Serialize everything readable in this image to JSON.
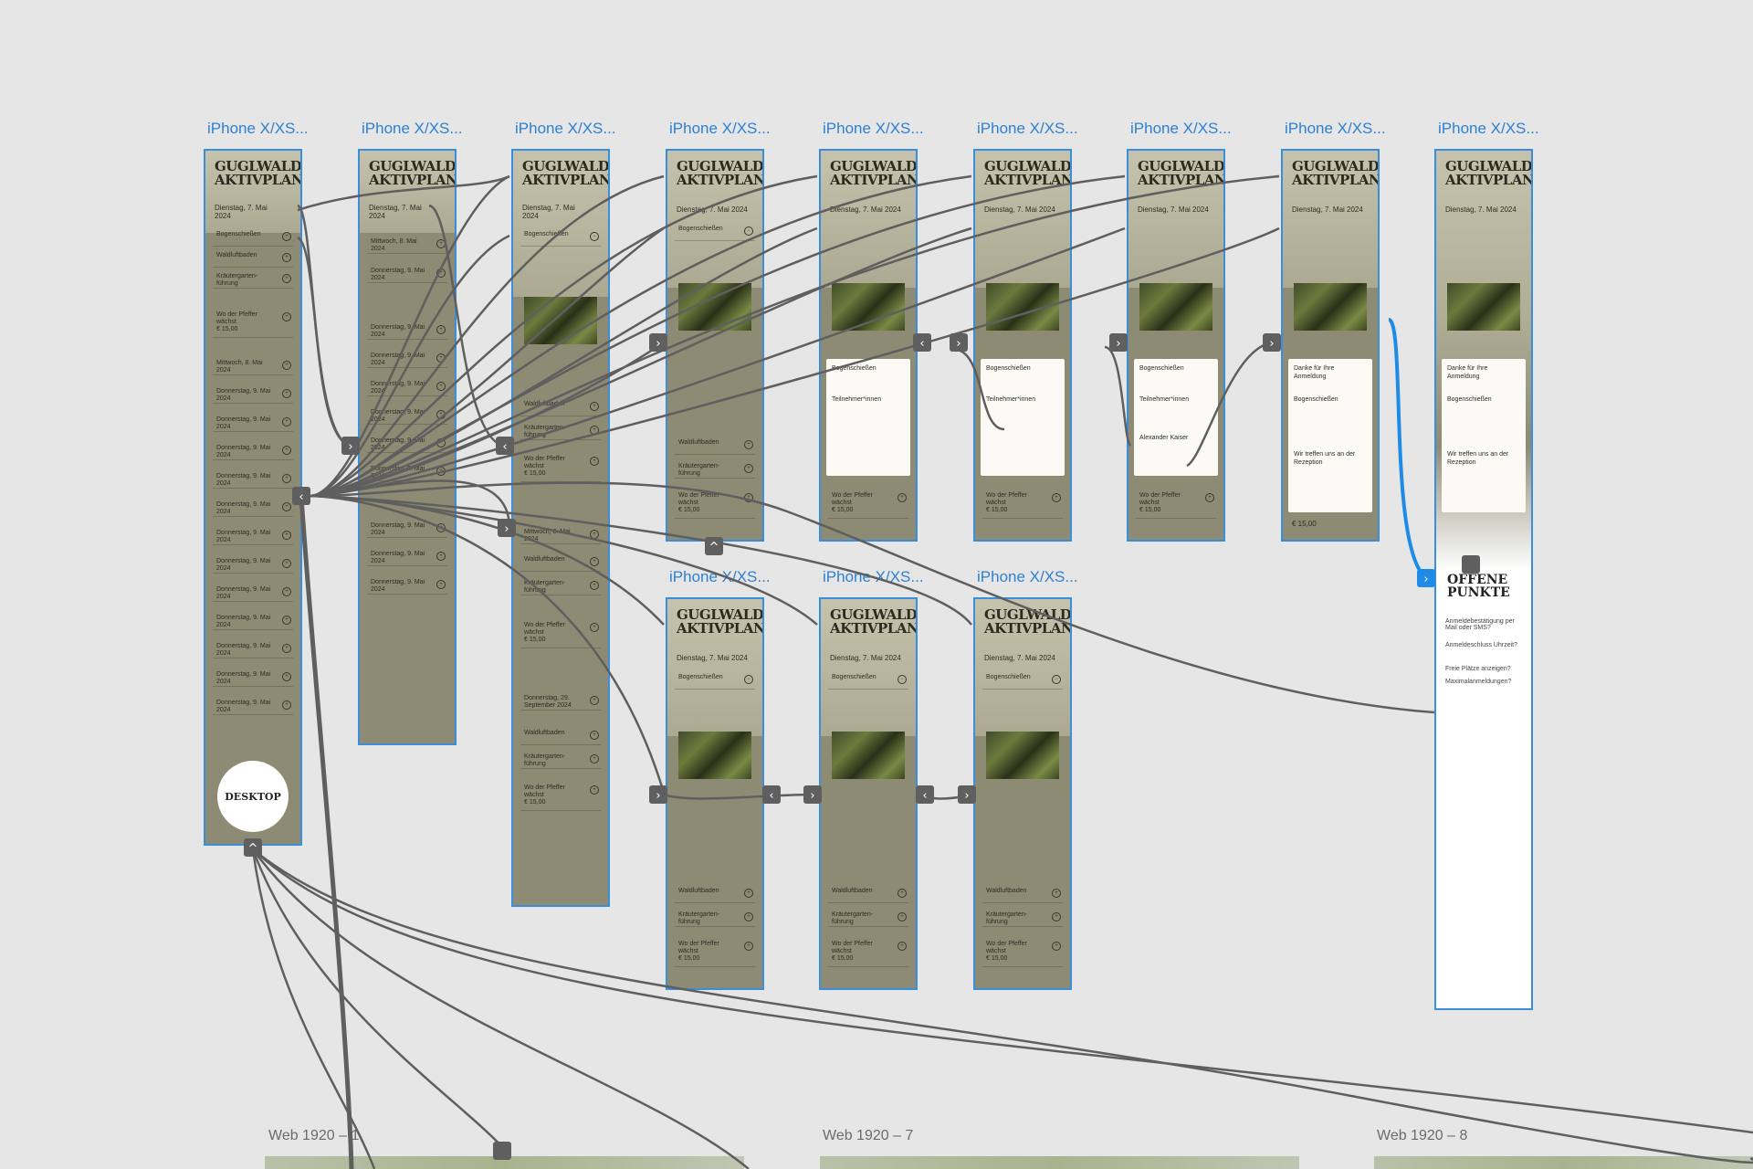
{
  "artboard_label": "iPhone X/XS...",
  "logo_line1": "GUGLWALD",
  "logo_line2": "AKTIVPLAN",
  "desktop_label": "DESKTOP",
  "web_labels": [
    "Web 1920 – 1",
    "Web 1920 – 7",
    "Web 1920 – 8"
  ],
  "offene_line1": "OFFENE",
  "offene_line2": "PUNKTE",
  "offene_items": [
    "Anmeldebestätigung per Mail oder SMS?",
    "Anmeldeschluss Uhrzeit?",
    "Freie Plätze anzeigen?",
    "Maximalanmeldungen?"
  ],
  "date_short": "Dienstag, 7. Mai 2024",
  "list_rows": [
    "Bogenschießen",
    "Waldluftbaden",
    "Kräutergarten-führung",
    "Wo der Pfeffer wächst"
  ],
  "price": "€ 15,00",
  "list_dates": [
    "Mittwoch, 8. Mai 2024",
    "Donnerstag, 9. Mai 2024",
    "Donnerstag, 9. Mai 2024",
    "Donnerstag, 9. Mai 2024",
    "Donnerstag, 9. Mai 2024",
    "Donnerstag, 9. Mai 2024",
    "Donnerstag, 9. Mai 2024",
    "Donnerstag, 9. Mai 2024",
    "Donnerstag, 9. Mai 2024",
    "Donnerstag, 9. Mai 2024",
    "Donnerstag, 9. Mai 2024",
    "Donnerstag, 9. Mai 2024",
    "Donnerstag, 9. Mai 2024"
  ],
  "card_title": "Bogenschießen",
  "card_participants": "Teilnehmer*innen",
  "card_name": "Alexander Kaiser",
  "thanks_title": "Danke für Ihre Anmeldung",
  "meet_text": "Wir treffen uns an der Rezeption",
  "date_sept": "Donnerstag, 29. September 2024"
}
